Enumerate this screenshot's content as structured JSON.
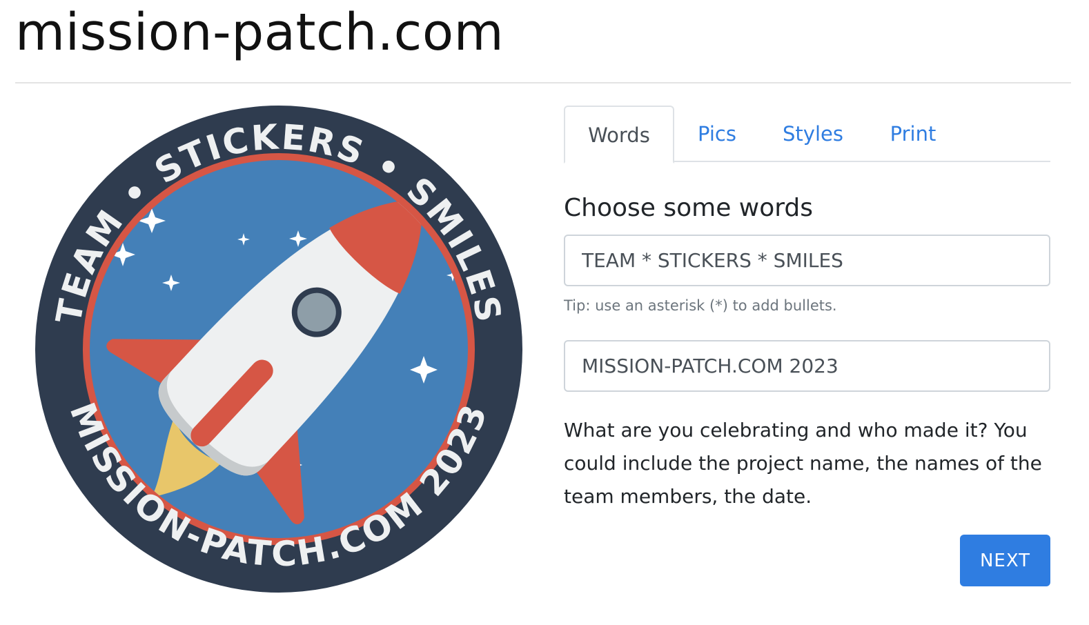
{
  "header": {
    "site_title": "mission-patch.com"
  },
  "patch": {
    "top_text": "TEAM • STICKERS • SMILES",
    "bottom_text": "MISSION-PATCH.COM 2023",
    "colors": {
      "ring": "#2f3c4f",
      "inner_border": "#d65645",
      "sky": "#4480b8",
      "rocket_body": "#eef0f1",
      "rocket_red": "#d65645",
      "flame": "#e8c66a",
      "window": "#8e9ea8",
      "star": "#ffffff"
    }
  },
  "tabs": [
    {
      "label": "Words",
      "active": true
    },
    {
      "label": "Pics",
      "active": false
    },
    {
      "label": "Styles",
      "active": false
    },
    {
      "label": "Print",
      "active": false
    }
  ],
  "form": {
    "heading": "Choose some words",
    "top_words_value": "TEAM * STICKERS * SMILES",
    "tip": "Tip: use an asterisk (*) to add bullets.",
    "bottom_words_value": "MISSION-PATCH.COM 2023",
    "description": "What are you celebrating and who made it? You could include the project name, the names of the team members, the date.",
    "next_label": "NEXT"
  },
  "theme": {
    "accent": "#2f7de1"
  }
}
